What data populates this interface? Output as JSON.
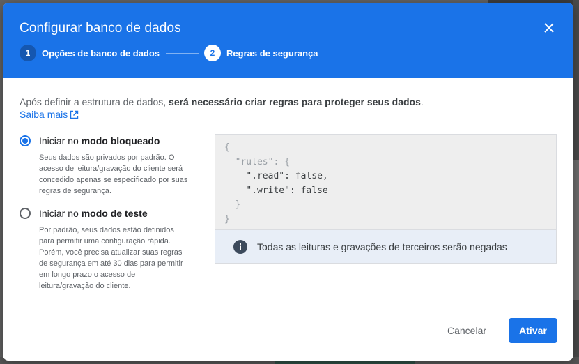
{
  "dialog": {
    "title": "Configurar banco de dados",
    "close_icon": "close-icon"
  },
  "stepper": {
    "steps": [
      {
        "number": "1",
        "label": "Opções de banco de dados",
        "state": "completed"
      },
      {
        "number": "2",
        "label": "Regras de segurança",
        "state": "active"
      }
    ]
  },
  "intro": {
    "text_prefix": "Após definir a estrutura de dados, ",
    "text_bold": "será necessário criar regras para proteger seus dados",
    "text_suffix": ".",
    "learn_more": "Saiba mais",
    "learn_more_icon": "open-in-new-icon"
  },
  "options": [
    {
      "label_prefix": "Iniciar no ",
      "label_bold": "modo bloqueado",
      "description": "Seus dados são privados por padrão. O acesso de leitura/gravação do cliente será concedido apenas se especificado por suas regras de segurança.",
      "selected": true
    },
    {
      "label_prefix": "Iniciar no ",
      "label_bold": "modo de teste",
      "description": "Por padrão, seus dados estão definidos para permitir uma configuração rápida. Porém, você precisa atualizar suas regras de segurança em até 30 dias para permitir em longo prazo o acesso de leitura/gravação do cliente.",
      "selected": false
    }
  ],
  "code": {
    "line1": "{",
    "line2_key": "\"rules\"",
    "line2_rest": ": {",
    "line3_key": "\".read\"",
    "line3_rest": ": false,",
    "line4_key": "\".write\"",
    "line4_rest": ": false",
    "line5": "}",
    "line6": "}"
  },
  "info": {
    "icon": "info-icon",
    "text": "Todas as leituras e gravações de terceiros serão negadas"
  },
  "actions": {
    "cancel_label": "Cancelar",
    "enable_label": "Ativar"
  },
  "colors": {
    "primary": "#1a73e8",
    "header_bg": "#1a73e8",
    "code_bg": "#eeeeee",
    "info_bg": "#e8eef7"
  }
}
